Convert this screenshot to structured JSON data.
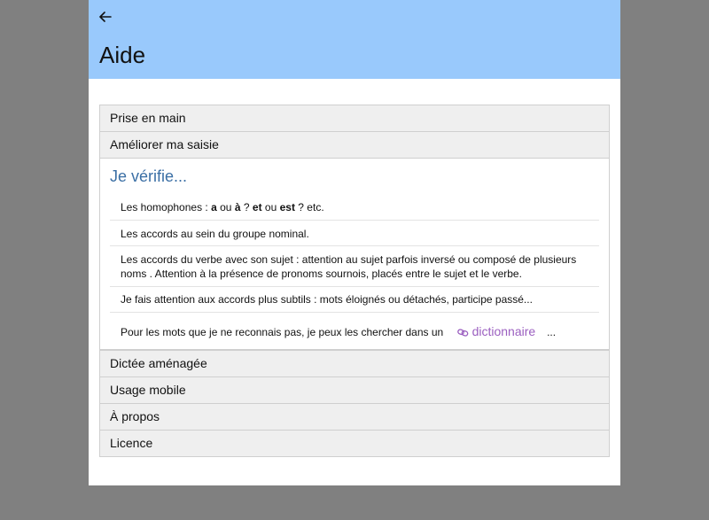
{
  "header": {
    "back_icon": "arrow-left-icon",
    "title": "Aide",
    "background": "#99c9fc"
  },
  "accordion": {
    "sections_before": [
      {
        "label": "Prise en main"
      },
      {
        "label": "Améliorer ma saisie"
      }
    ],
    "open_section": {
      "title": "Je vérifie...",
      "items": {
        "homophones": {
          "prefix": "Les homophones :",
          "a": "a",
          "ou1": "ou",
          "a_accent": "à",
          "q": "?",
          "et": "et",
          "ou2": "ou",
          "est": "est",
          "suffix": "? etc."
        },
        "nominal": "Les accords au sein du groupe nominal.",
        "verbe": "Les accords du verbe avec son sujet : attention au sujet parfois inversé ou composé de plusieurs noms . Attention à la présence de pronoms sournois, placés entre le sujet et le verbe.",
        "subtils": "Je fais attention aux accords plus subtils : mots éloignés ou détachés, participe passé...",
        "dictionnaire": {
          "text": "Pour les mots que je ne reconnais pas, je peux les chercher dans un",
          "link_label": "dictionnaire",
          "link_icon": "link-icon",
          "ellipsis": "..."
        }
      }
    },
    "sections_after": [
      {
        "label": "Dictée aménagée"
      },
      {
        "label": "Usage mobile"
      },
      {
        "label": "À propos"
      },
      {
        "label": "Licence"
      }
    ]
  },
  "colors": {
    "page_background": "#808080",
    "section_title": "#3b6fa5",
    "link": "#9b5fc0"
  }
}
